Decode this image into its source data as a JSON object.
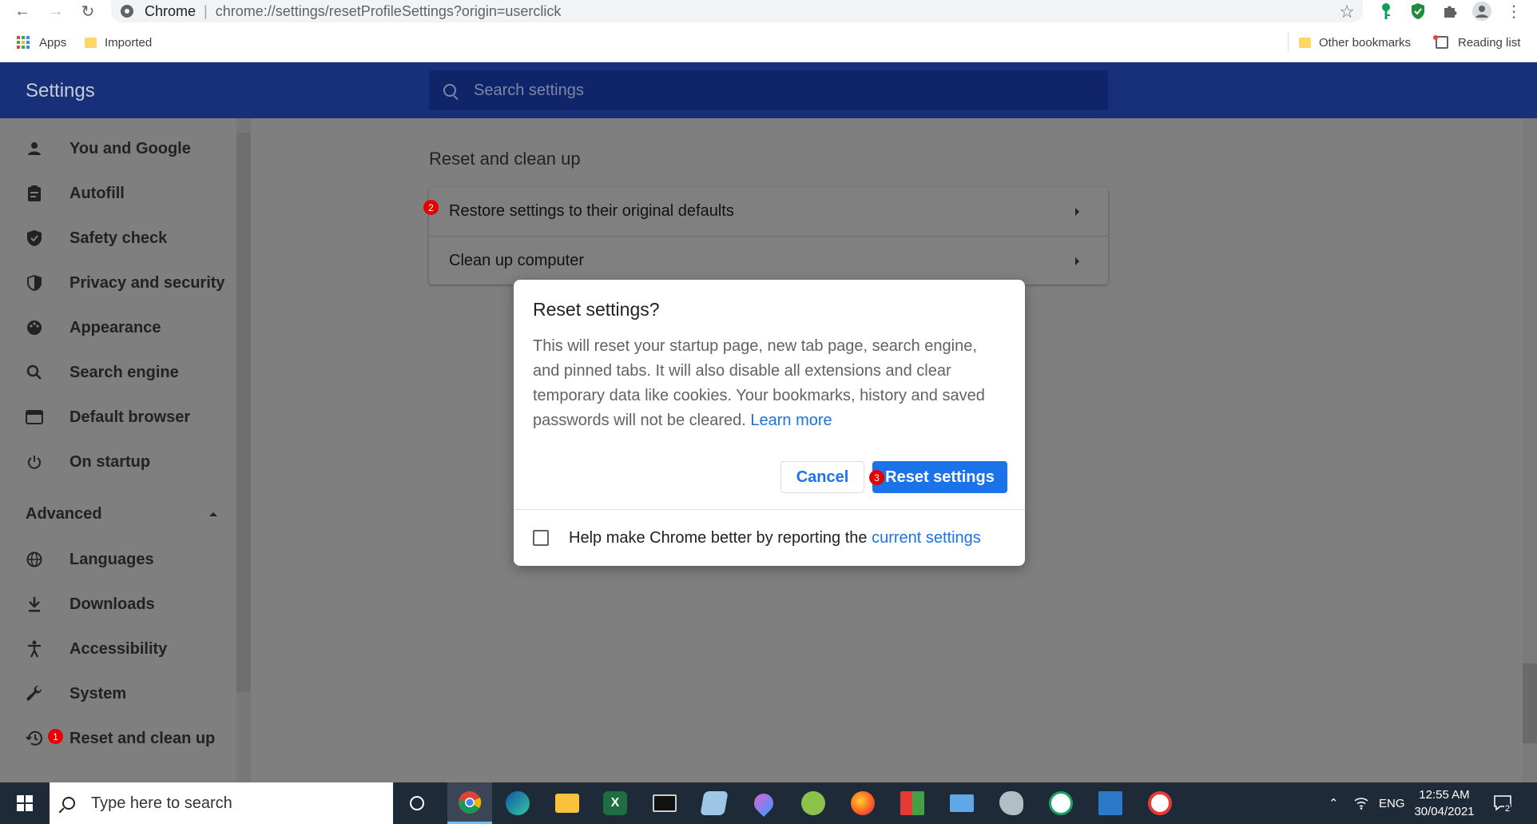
{
  "browser": {
    "origin": "Chrome",
    "url": "chrome://settings/resetProfileSettings?origin=userclick"
  },
  "bookmarks": {
    "apps": "Apps",
    "imported": "Imported",
    "other": "Other bookmarks",
    "reading_list": "Reading list"
  },
  "settings": {
    "title": "Settings",
    "search_placeholder": "Search settings"
  },
  "sidebar": {
    "items": [
      {
        "label": "You and Google",
        "icon": "person-icon"
      },
      {
        "label": "Autofill",
        "icon": "clipboard-icon"
      },
      {
        "label": "Safety check",
        "icon": "shield-check-icon"
      },
      {
        "label": "Privacy and security",
        "icon": "shield-icon"
      },
      {
        "label": "Appearance",
        "icon": "palette-icon"
      },
      {
        "label": "Search engine",
        "icon": "search-icon"
      },
      {
        "label": "Default browser",
        "icon": "browser-icon"
      },
      {
        "label": "On startup",
        "icon": "power-icon"
      }
    ],
    "advanced_label": "Advanced",
    "advanced_items": [
      {
        "label": "Languages",
        "icon": "globe-icon"
      },
      {
        "label": "Downloads",
        "icon": "download-icon"
      },
      {
        "label": "Accessibility",
        "icon": "accessibility-icon"
      },
      {
        "label": "System",
        "icon": "wrench-icon"
      },
      {
        "label": "Reset and clean up",
        "icon": "history-icon"
      }
    ]
  },
  "main": {
    "section_title": "Reset and clean up",
    "rows": [
      {
        "label": "Restore settings to their original defaults"
      },
      {
        "label": "Clean up computer"
      }
    ]
  },
  "badges": {
    "b1": "1",
    "b2": "2",
    "b3": "3"
  },
  "dialog": {
    "title": "Reset settings?",
    "body": "This will reset your startup page, new tab page, search engine, and pinned tabs. It will also disable all extensions and clear temporary data like cookies. Your bookmarks, history and saved passwords will not be cleared.",
    "learn_more": "Learn more",
    "cancel": "Cancel",
    "reset": "Reset settings",
    "checkbox_label": "Help make Chrome better by reporting the",
    "checkbox_link": "current settings",
    "checkbox_checked": false
  },
  "taskbar": {
    "search_placeholder": "Type here to search",
    "language": "ENG",
    "time": "12:55 AM",
    "date": "30/04/2021",
    "notifications": "2"
  },
  "colors": {
    "header": "#18307a",
    "accent": "#1a73e8",
    "badge": "#e60000",
    "overlay": "#7f7f7f"
  }
}
